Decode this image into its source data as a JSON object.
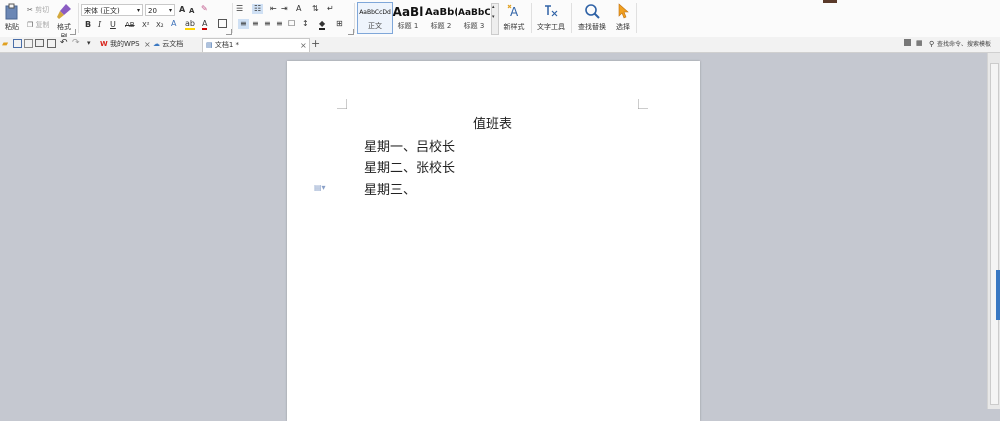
{
  "ribbon": {
    "paste": "粘贴",
    "cut": "剪切",
    "copy": "复制",
    "format_painter": "格式刷",
    "font_name": "宋体 (正文)",
    "font_size": "20",
    "grow_font": "A",
    "shrink_font": "A",
    "bold": "B",
    "italic": "I",
    "underline": "U",
    "strike": "AB",
    "superscript": "X²",
    "subscript": "X₂",
    "styles": [
      {
        "sample": "AaBbCcDd",
        "name": "正文"
      },
      {
        "sample": "AaBl",
        "name": "标题 1"
      },
      {
        "sample": "AaBb(",
        "name": "标题 2"
      },
      {
        "sample": "AaBbC",
        "name": "标题 3"
      }
    ],
    "new_style": "新样式",
    "text_tools": "文字工具",
    "find_replace": "查找替换",
    "select": "选择"
  },
  "tabbar": {
    "tabs": [
      {
        "label": "我的WPS"
      },
      {
        "label": "云文档"
      },
      {
        "label": "文档1 *"
      }
    ],
    "add_tab": "+",
    "search_placeholder": "查找命令、搜索模板"
  },
  "document": {
    "title": "值班表",
    "lines": [
      "星期一、吕校长",
      "星期二、张校长",
      "星期三、"
    ]
  },
  "colors": {
    "workspace_bg": "#c5c8d0",
    "accent": "#3a78c2",
    "wps_red": "#d9251c"
  }
}
